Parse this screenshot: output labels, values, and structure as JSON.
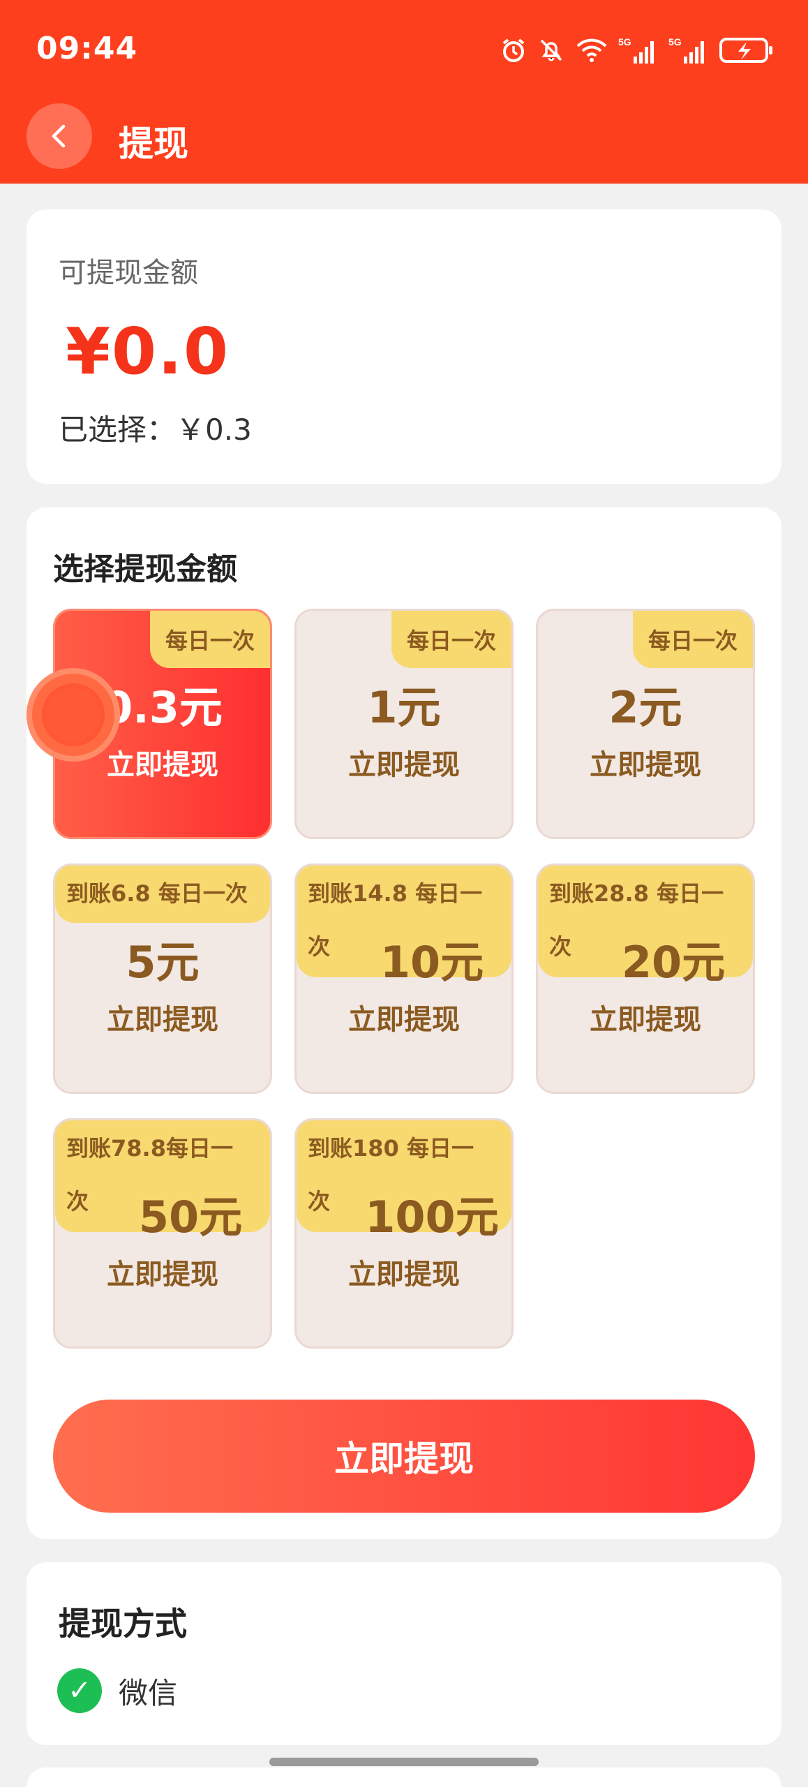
{
  "status_bar": {
    "time": "09:44",
    "icons": [
      "alarm-icon",
      "mute-icon",
      "wifi-icon",
      "signal-5g-icon",
      "signal-5g-icon",
      "battery-charging-icon"
    ]
  },
  "header": {
    "title": "提现",
    "back_icon": "chevron-left-icon",
    "bg_color": "#fe3f1d"
  },
  "balance": {
    "label": "可提现金额",
    "amount": "¥0.0",
    "selected_text": "已选择：￥0.3"
  },
  "amount_section": {
    "title": "选择提现金额",
    "options": [
      {
        "value": "0.3元",
        "badge": "每日一次",
        "action": "立即提现",
        "selected": true
      },
      {
        "value": "1元",
        "badge": "每日一次",
        "action": "立即提现",
        "selected": false
      },
      {
        "value": "2元",
        "badge": "每日一次",
        "action": "立即提现",
        "selected": false
      },
      {
        "value": "5元",
        "badge": "到账6.8 每日一次",
        "action": "立即提现",
        "selected": false
      },
      {
        "value": "10元",
        "badge": "到账14.8 每日一次",
        "action": "立即提现",
        "selected": false
      },
      {
        "value": "20元",
        "badge": "到账28.8 每日一次",
        "action": "立即提现",
        "selected": false
      },
      {
        "value": "50元",
        "badge": "到账78.8每日一次",
        "action": "立即提现",
        "selected": false
      },
      {
        "value": "100元",
        "badge": "到账180 每日一次",
        "action": "立即提现",
        "selected": false
      }
    ],
    "submit_label": "立即提现"
  },
  "method": {
    "title": "提现方式",
    "option_label": "微信",
    "check_icon": "check-circle-icon",
    "check_color": "#1dbe54"
  }
}
